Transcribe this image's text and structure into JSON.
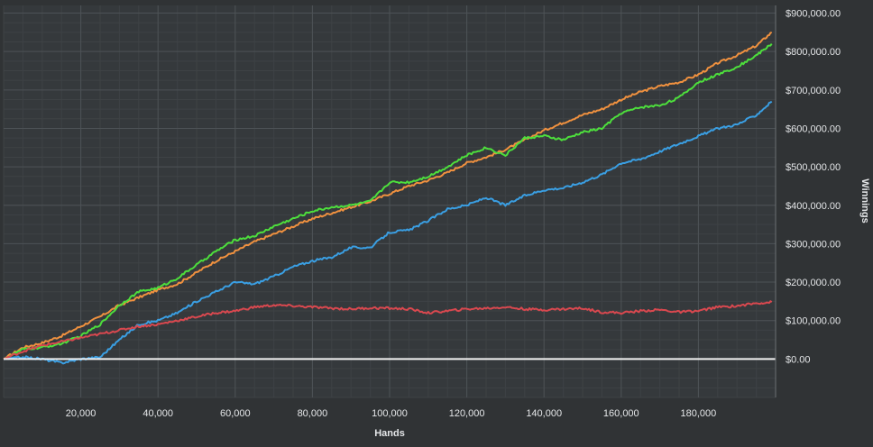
{
  "chart_data": {
    "type": "line",
    "title": "",
    "xlabel": "Hands",
    "ylabel": "Winnings",
    "xlim": [
      0,
      200000
    ],
    "ylim": [
      -100000,
      920000
    ],
    "grid": true,
    "legend": "none",
    "y_axis_side": "right",
    "x_ticks": [
      {
        "value": 20000,
        "label": "20,000"
      },
      {
        "value": 40000,
        "label": "40,000"
      },
      {
        "value": 60000,
        "label": "60,000"
      },
      {
        "value": 80000,
        "label": "80,000"
      },
      {
        "value": 100000,
        "label": "100,000"
      },
      {
        "value": 120000,
        "label": "120,000"
      },
      {
        "value": 140000,
        "label": "140,000"
      },
      {
        "value": 160000,
        "label": "160,000"
      },
      {
        "value": 180000,
        "label": "180,000"
      }
    ],
    "y_ticks": [
      {
        "value": 0,
        "label": "$0.00"
      },
      {
        "value": 100000,
        "label": "$100,000.00"
      },
      {
        "value": 200000,
        "label": "$200,000.00"
      },
      {
        "value": 300000,
        "label": "$300,000.00"
      },
      {
        "value": 400000,
        "label": "$400,000.00"
      },
      {
        "value": 500000,
        "label": "$500,000.00"
      },
      {
        "value": 600000,
        "label": "$600,000.00"
      },
      {
        "value": 700000,
        "label": "$700,000.00"
      },
      {
        "value": 800000,
        "label": "$800,000.00"
      },
      {
        "value": 900000,
        "label": "$900,000.00"
      }
    ],
    "zero_line_color": "#f2f2f2",
    "series": [
      {
        "color": "#f0913f",
        "x": [
          0,
          5000,
          10000,
          15000,
          20000,
          25000,
          30000,
          35000,
          40000,
          45000,
          50000,
          55000,
          60000,
          65000,
          70000,
          75000,
          80000,
          85000,
          90000,
          95000,
          100000,
          105000,
          110000,
          115000,
          120000,
          125000,
          130000,
          135000,
          140000,
          145000,
          150000,
          155000,
          160000,
          165000,
          170000,
          175000,
          180000,
          185000,
          190000,
          195000,
          199000
        ],
        "y": [
          0,
          30000,
          42000,
          60000,
          85000,
          110000,
          140000,
          160000,
          180000,
          195000,
          225000,
          255000,
          280000,
          305000,
          325000,
          345000,
          365000,
          380000,
          395000,
          410000,
          430000,
          450000,
          465000,
          485000,
          510000,
          525000,
          545000,
          570000,
          595000,
          615000,
          635000,
          650000,
          675000,
          695000,
          710000,
          720000,
          740000,
          770000,
          790000,
          815000,
          850000
        ]
      },
      {
        "color": "#4ddf3c",
        "x": [
          0,
          5000,
          10000,
          15000,
          20000,
          25000,
          30000,
          35000,
          40000,
          45000,
          50000,
          55000,
          60000,
          65000,
          70000,
          75000,
          80000,
          85000,
          90000,
          95000,
          100000,
          105000,
          110000,
          115000,
          120000,
          125000,
          130000,
          135000,
          140000,
          145000,
          150000,
          155000,
          160000,
          165000,
          170000,
          175000,
          180000,
          185000,
          190000,
          195000,
          199000
        ],
        "y": [
          0,
          25000,
          30000,
          40000,
          60000,
          90000,
          140000,
          175000,
          185000,
          210000,
          245000,
          280000,
          310000,
          320000,
          345000,
          365000,
          385000,
          395000,
          400000,
          410000,
          460000,
          460000,
          475000,
          500000,
          530000,
          550000,
          530000,
          575000,
          580000,
          570000,
          590000,
          600000,
          640000,
          655000,
          660000,
          680000,
          720000,
          740000,
          760000,
          790000,
          820000
        ]
      },
      {
        "color": "#3a9fe3",
        "x": [
          0,
          5000,
          10000,
          15000,
          20000,
          25000,
          30000,
          35000,
          40000,
          45000,
          50000,
          55000,
          60000,
          65000,
          70000,
          75000,
          80000,
          85000,
          90000,
          95000,
          100000,
          105000,
          110000,
          115000,
          120000,
          125000,
          130000,
          135000,
          140000,
          145000,
          150000,
          155000,
          160000,
          165000,
          170000,
          175000,
          180000,
          185000,
          190000,
          195000,
          199000
        ],
        "y": [
          0,
          5000,
          0,
          -10000,
          0,
          5000,
          50000,
          90000,
          100000,
          120000,
          150000,
          175000,
          200000,
          195000,
          215000,
          240000,
          255000,
          265000,
          290000,
          290000,
          330000,
          335000,
          360000,
          390000,
          400000,
          420000,
          400000,
          425000,
          440000,
          445000,
          460000,
          480000,
          510000,
          520000,
          540000,
          560000,
          580000,
          600000,
          610000,
          635000,
          670000
        ]
      },
      {
        "color": "#d9484f",
        "x": [
          0,
          5000,
          10000,
          15000,
          20000,
          25000,
          30000,
          35000,
          40000,
          45000,
          50000,
          55000,
          60000,
          65000,
          70000,
          75000,
          80000,
          85000,
          90000,
          95000,
          100000,
          105000,
          110000,
          115000,
          120000,
          125000,
          130000,
          135000,
          140000,
          145000,
          150000,
          155000,
          160000,
          165000,
          170000,
          175000,
          180000,
          185000,
          190000,
          195000,
          199000
        ],
        "y": [
          0,
          20000,
          35000,
          45000,
          55000,
          65000,
          75000,
          85000,
          90000,
          100000,
          110000,
          120000,
          125000,
          135000,
          140000,
          138000,
          135000,
          132000,
          130000,
          133000,
          132000,
          130000,
          120000,
          125000,
          130000,
          132000,
          135000,
          130000,
          128000,
          130000,
          132000,
          122000,
          120000,
          125000,
          128000,
          122000,
          125000,
          135000,
          138000,
          145000,
          148000
        ]
      }
    ]
  }
}
